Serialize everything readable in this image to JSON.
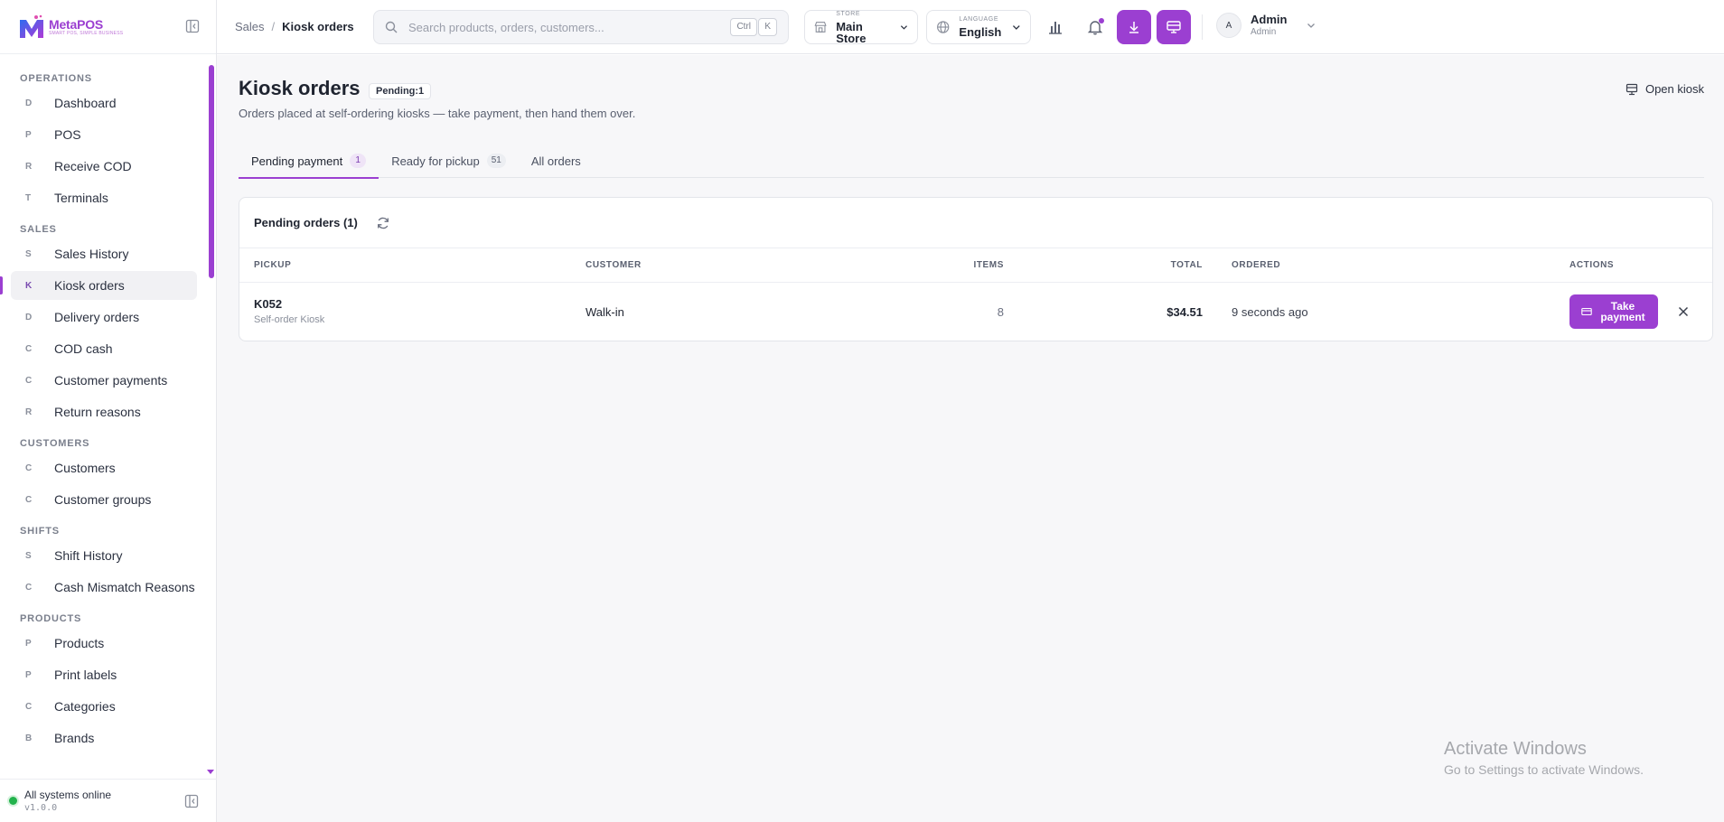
{
  "brand": {
    "name": "MetaPOS",
    "tagline": "SMART POS, SIMPLE BUSINESS"
  },
  "sidebar": {
    "sections": [
      {
        "title": "OPERATIONS",
        "items": [
          {
            "letter": "D",
            "label": "Dashboard"
          },
          {
            "letter": "P",
            "label": "POS"
          },
          {
            "letter": "R",
            "label": "Receive COD"
          },
          {
            "letter": "T",
            "label": "Terminals"
          }
        ]
      },
      {
        "title": "SALES",
        "items": [
          {
            "letter": "S",
            "label": "Sales History"
          },
          {
            "letter": "K",
            "label": "Kiosk orders",
            "active": true
          },
          {
            "letter": "D",
            "label": "Delivery orders"
          },
          {
            "letter": "C",
            "label": "COD cash"
          },
          {
            "letter": "C",
            "label": "Customer payments"
          },
          {
            "letter": "R",
            "label": "Return reasons"
          }
        ]
      },
      {
        "title": "CUSTOMERS",
        "items": [
          {
            "letter": "C",
            "label": "Customers"
          },
          {
            "letter": "C",
            "label": "Customer groups"
          }
        ]
      },
      {
        "title": "SHIFTS",
        "items": [
          {
            "letter": "S",
            "label": "Shift History"
          },
          {
            "letter": "C",
            "label": "Cash Mismatch Reasons"
          }
        ]
      },
      {
        "title": "PRODUCTS",
        "items": [
          {
            "letter": "P",
            "label": "Products"
          },
          {
            "letter": "P",
            "label": "Print labels"
          },
          {
            "letter": "C",
            "label": "Categories"
          },
          {
            "letter": "B",
            "label": "Brands"
          }
        ]
      }
    ],
    "footer": {
      "status": "All systems online",
      "version": "v1.0.0"
    }
  },
  "topbar": {
    "breadcrumb": [
      "Sales",
      "Kiosk orders"
    ],
    "search": {
      "placeholder": "Search products, orders, customers...",
      "value": "",
      "kbd_ctrl": "Ctrl",
      "kbd_k": "K"
    },
    "store": {
      "caption": "STORE",
      "value": "Main Store"
    },
    "language": {
      "caption": "LANGUAGE",
      "value": "English"
    },
    "user": {
      "initial": "A",
      "name": "Admin",
      "role": "Admin"
    }
  },
  "page": {
    "title": "Kiosk orders",
    "pending_badge": "Pending:1",
    "subtitle": "Orders placed at self-ordering kiosks — take payment, then hand them over.",
    "open_kiosk": "Open kiosk",
    "tabs": [
      {
        "label": "Pending payment",
        "count": "1",
        "active": true
      },
      {
        "label": "Ready for pickup",
        "count": "51"
      },
      {
        "label": "All orders",
        "count": ""
      }
    ],
    "card_title": "Pending orders (1)",
    "columns": {
      "pickup": "PICKUP",
      "customer": "CUSTOMER",
      "items": "ITEMS",
      "total": "TOTAL",
      "ordered": "ORDERED",
      "actions": "ACTIONS"
    },
    "rows": [
      {
        "pickup": "K052",
        "source": "Self-order Kiosk",
        "customer": "Walk-in",
        "items": "8",
        "total": "$34.51",
        "ordered": "9 seconds ago",
        "action": "Take payment"
      }
    ]
  },
  "watermark": {
    "title": "Activate Windows",
    "subtitle": "Go to Settings to activate Windows."
  },
  "colors": {
    "accent": "#9b3fd1",
    "status_online": "#22b24c"
  }
}
